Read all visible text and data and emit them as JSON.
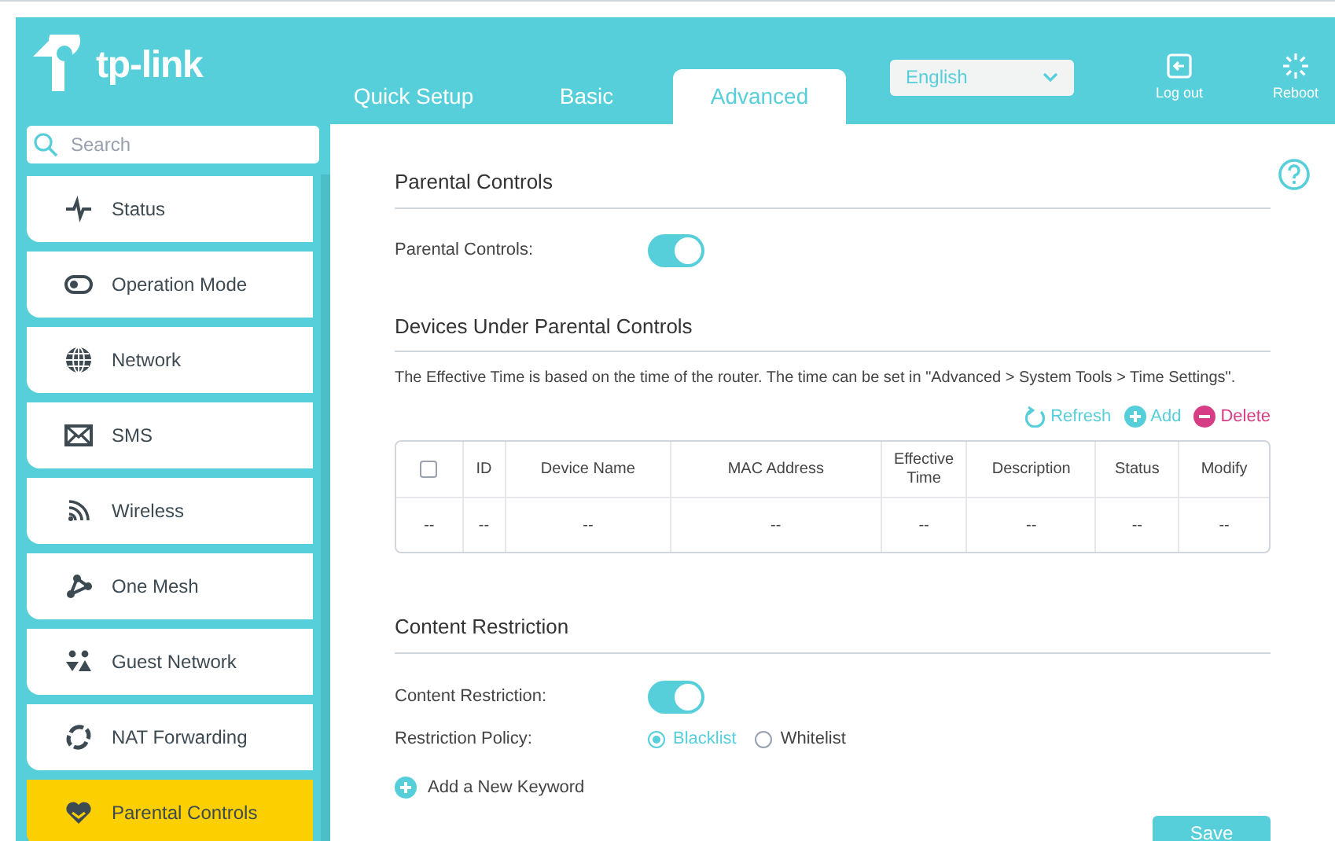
{
  "brand": {
    "name": "tp-link"
  },
  "tabs": [
    {
      "label": "Quick Setup",
      "selected": false
    },
    {
      "label": "Basic",
      "selected": false
    },
    {
      "label": "Advanced",
      "selected": true
    }
  ],
  "language": {
    "value": "English"
  },
  "header_actions": [
    {
      "label": "Log out",
      "kind": "logout"
    },
    {
      "label": "Reboot",
      "kind": "reboot"
    }
  ],
  "search": {
    "placeholder": "Search"
  },
  "sidebar": {
    "items": [
      {
        "label": "Status",
        "kind": "status",
        "selected": false
      },
      {
        "label": "Operation Mode",
        "kind": "mode",
        "selected": false
      },
      {
        "label": "Network",
        "kind": "network",
        "selected": false
      },
      {
        "label": "SMS",
        "kind": "sms",
        "selected": false
      },
      {
        "label": "Wireless",
        "kind": "wireless",
        "selected": false
      },
      {
        "label": "One Mesh",
        "kind": "mesh",
        "selected": false
      },
      {
        "label": "Guest Network",
        "kind": "guest",
        "selected": false
      },
      {
        "label": "NAT Forwarding",
        "kind": "nat",
        "selected": false
      },
      {
        "label": "Parental Controls",
        "kind": "parental",
        "selected": true
      }
    ]
  },
  "parental_controls": {
    "title": "Parental Controls",
    "toggle": {
      "label": "Parental Controls:",
      "on": true
    }
  },
  "devices": {
    "title": "Devices Under Parental Controls",
    "note": "The Effective Time is based on the time of the router. The time can be set in \"Advanced > System Tools > Time Settings\".",
    "actions": [
      {
        "label": "Refresh",
        "kind": "refresh"
      },
      {
        "label": "Add",
        "kind": "add"
      },
      {
        "label": "Delete",
        "kind": "delete"
      }
    ],
    "table": {
      "select_all": {
        "checked": false
      },
      "columns": [
        "",
        "ID",
        "Device Name",
        "MAC Address",
        "Effective Time",
        "Description",
        "Status",
        "Modify"
      ],
      "rows": [
        [
          "--",
          "--",
          "--",
          "--",
          "--",
          "--",
          "--",
          "--"
        ]
      ]
    }
  },
  "content_restriction": {
    "title": "Content Restriction",
    "toggle": {
      "label": "Content Restriction:",
      "on": true
    },
    "policy": {
      "label": "Restriction Policy:",
      "options": [
        {
          "label": "Blacklist",
          "selected": true
        },
        {
          "label": "Whitelist",
          "selected": false
        }
      ]
    },
    "add_keyword": "Add a New Keyword",
    "save": "Save"
  }
}
